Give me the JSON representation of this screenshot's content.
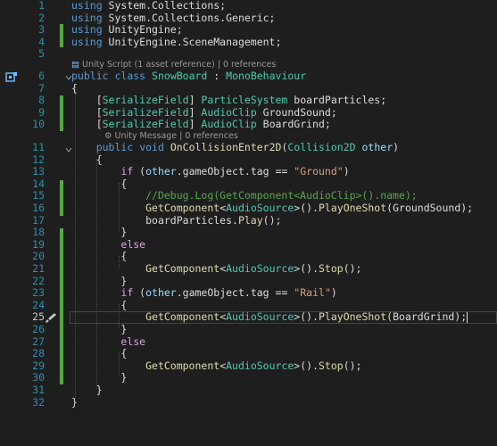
{
  "line_numbers": [
    "1",
    "2",
    "3",
    "4",
    "5",
    "6",
    "7",
    "8",
    "9",
    "10",
    "11",
    "12",
    "13",
    "14",
    "15",
    "16",
    "17",
    "18",
    "19",
    "20",
    "21",
    "22",
    "23",
    "24",
    "25",
    "26",
    "27",
    "28",
    "29",
    "30",
    "31",
    "32"
  ],
  "lens": {
    "class_lens": "Unity Script (1 asset reference) | 0 references",
    "method_lens": "Unity Message | 0 references"
  },
  "code": {
    "l1": {
      "kw": "using",
      "rest": " System.Collections;"
    },
    "l2": {
      "kw": "using",
      "rest": " System.Collections.Generic;"
    },
    "l3": {
      "kw": "using",
      "rest": " UnityEngine;"
    },
    "l4": {
      "kw": "using",
      "rest": " UnityEngine.SceneManagement;"
    },
    "l6": {
      "a": "public",
      "b": "class",
      "name": "SnowBoard",
      "sep": " : ",
      "base": "MonoBehaviour"
    },
    "l7": "{",
    "l8": {
      "attr": "SerializeField",
      "type": "ParticleSystem",
      "field": " boardParticles;"
    },
    "l9": {
      "attr": "SerializeField",
      "type": "AudioClip",
      "field": " GroundSound;"
    },
    "l10": {
      "attr": "SerializeField",
      "type": "AudioClip",
      "field": " BoardGrind;"
    },
    "l11": {
      "a": "public",
      "b": "void",
      "name": "OnCollisionEnter2D",
      "open": "(",
      "ptype": "Collision2D",
      "param": "other",
      ")": ")"
    },
    "l12": "{",
    "l13": {
      "if": "if",
      "pre": " (",
      "var": "other",
      ".gameObject.tag == ": ".gameObject.tag == ",
      "str": "\"Ground\"",
      "close": ")"
    },
    "l14": "{",
    "l15": "//Debug.Log(GetComponent<AudioClip>().name);",
    "l16": {
      "m": "GetComponent",
      "lt": "<",
      "t": "AudioSource",
      "gt": ">().",
      "m2": "PlayOneShot",
      "arg": "(GroundSound);"
    },
    "l17": {
      "pre": "boardParticles.",
      "m": "Play",
      "post": "();"
    },
    "l18": "}",
    "l19": "else",
    "l20": "{",
    "l21": {
      "m": "GetComponent",
      "lt": "<",
      "t": "AudioSource",
      "gt": ">().",
      "m2": "Stop",
      "arg": "();"
    },
    "l22": "}",
    "l23": {
      "if": "if",
      "pre": " (",
      "var": "other",
      ".gameObject.tag == ": ".gameObject.tag == ",
      "str": "\"Rail\"",
      "close": ")"
    },
    "l24": "{",
    "l25": {
      "m": "GetComponent",
      "lt": "<",
      "t": "AudioSource",
      "gt": ">().",
      "m2": "PlayOneShot",
      "arg": "(BoardGrind);"
    },
    "l26": "}",
    "l27": "else",
    "l28": "{",
    "l29": {
      "m": "GetComponent",
      "lt": "<",
      "t": "AudioSource",
      "gt": ">().",
      "m2": "Stop",
      "arg": "();"
    },
    "l30": "}",
    "l31": "}",
    "l32": "}"
  },
  "colors": {
    "background": "#1e1e1e",
    "keyword": "#569cd6",
    "type": "#4ec9b0",
    "string": "#d69d85",
    "comment": "#57a64a",
    "method": "#dcdcaa",
    "line_number": "#2b91af",
    "change_bar": "#57a64a"
  },
  "icons": {
    "class_glyph": "class-icon",
    "edit_glyph": "quick-action-brush-icon"
  }
}
